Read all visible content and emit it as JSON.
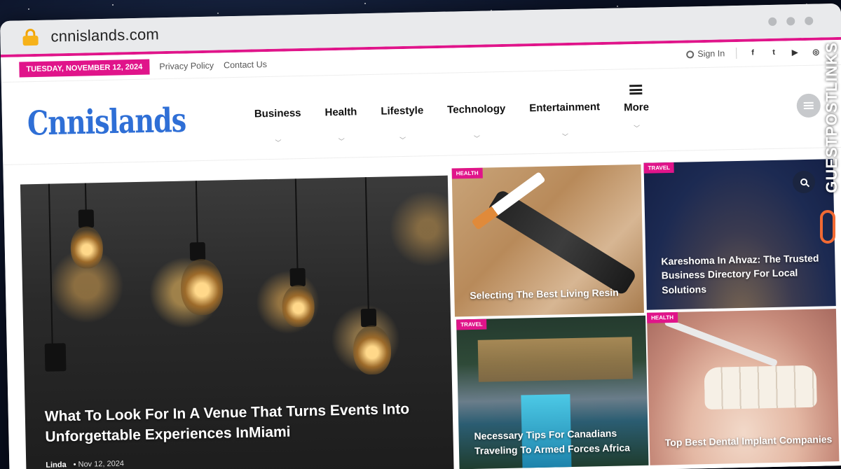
{
  "browser": {
    "url": "cnnislands.com"
  },
  "topbar": {
    "date": "TUESDAY, NOVEMBER 12, 2024",
    "links": [
      "Privacy Policy",
      "Contact Us"
    ],
    "sign_in": "Sign In",
    "social": [
      "f",
      "t",
      "▶",
      "◎"
    ]
  },
  "header": {
    "logo": "Cnnislands",
    "nav": [
      "Business",
      "Health",
      "Lifestyle",
      "Technology",
      "Entertainment"
    ],
    "more_label": "More"
  },
  "posts": {
    "featured": {
      "title": "What To Look For In A Venue That Turns Events Into Unforgettable Experiences InMiami",
      "author": "Linda",
      "date": "Nov 12, 2024"
    },
    "items": [
      {
        "tag": "HEALTH",
        "title": "Selecting The Best Living Resin"
      },
      {
        "tag": "TRAVEL",
        "title": "Kareshoma In Ahvaz: The Trusted Business Directory For Local Solutions"
      },
      {
        "tag": "TRAVEL",
        "title": "Necessary Tips For Canadians Traveling To Armed Forces Africa"
      },
      {
        "tag": "HEALTH",
        "title": "Top Best Dental Implant Companies"
      }
    ]
  },
  "watermark": "GUESTPOSTLINKS",
  "colors": {
    "accent": "#e0148a",
    "logo": "#2f6fd6"
  }
}
